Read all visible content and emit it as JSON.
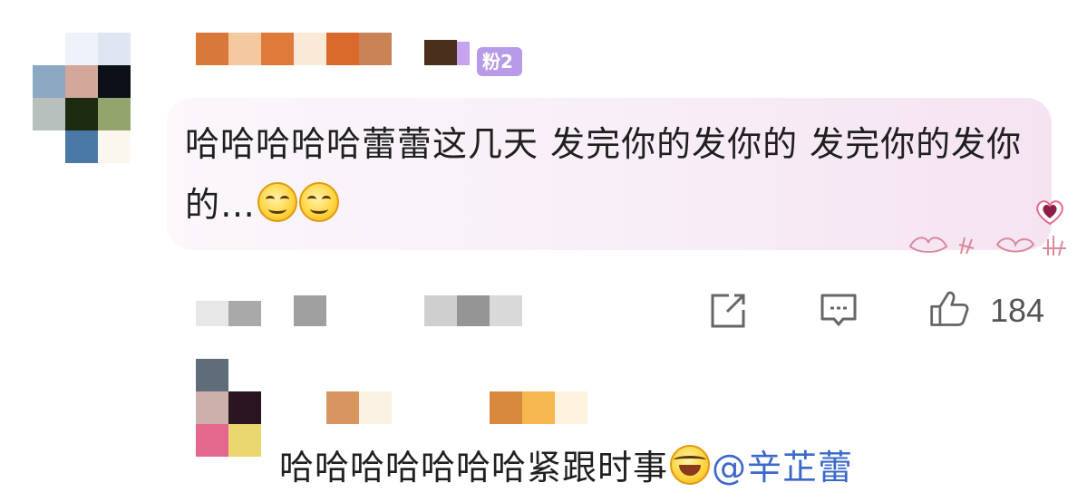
{
  "comment": {
    "badge": "粉2",
    "text": "哈哈哈哈哈蕾蕾这几天 发完你的发你的 发完你的发你的…",
    "likes": "184"
  },
  "reply": {
    "text": "哈哈哈哈哈哈哈紧跟时事",
    "mention": "@辛芷蕾"
  },
  "icons": {
    "share": "share-icon",
    "comment": "comment-icon",
    "like": "thumbs-up-icon"
  },
  "colors": {
    "badge_bg": "#b79be8",
    "mention": "#3b68c9",
    "bubble_gradient_end": "#f5e3f1"
  }
}
